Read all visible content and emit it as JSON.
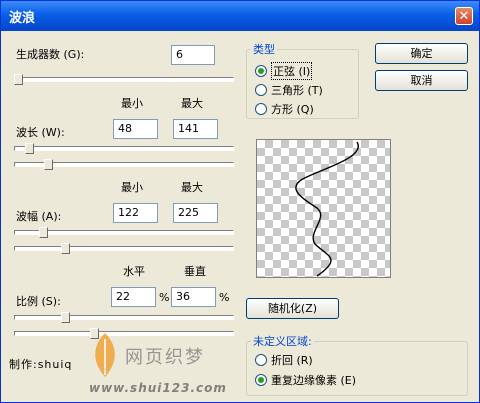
{
  "window": {
    "title": "波浪",
    "close_glyph": "✕"
  },
  "generators": {
    "label": "生成器数",
    "key": "(G):",
    "value": "6",
    "slider_fraction": 0.0
  },
  "min_max_header_1": {
    "min": "最小",
    "max": "最大"
  },
  "wavelength": {
    "label": "波长",
    "key": "(W):",
    "min": "48",
    "max": "141",
    "min_fraction": 0.05,
    "max_fraction": 0.14
  },
  "min_max_header_2": {
    "min": "最小",
    "max": "最大"
  },
  "amplitude": {
    "label": "波幅",
    "key": "(A):",
    "min": "122",
    "max": "225",
    "min_fraction": 0.12,
    "max_fraction": 0.22
  },
  "hv_header": {
    "h": "水平",
    "v": "垂直"
  },
  "scale": {
    "label": "比例",
    "key": "(S):",
    "h": "22",
    "v": "36",
    "unit": "%",
    "h_fraction": 0.22,
    "v_fraction": 0.36
  },
  "type_group": {
    "legend": "类型",
    "options": [
      {
        "label": "正弦",
        "key": "(I)",
        "selected": true
      },
      {
        "label": "三角形",
        "key": "(T)",
        "selected": false
      },
      {
        "label": "方形",
        "key": "(Q)",
        "selected": false
      }
    ]
  },
  "buttons": {
    "ok": "确定",
    "cancel": "取消",
    "randomize": "随机化(Z)"
  },
  "undefined_group": {
    "legend": "未定义区域:",
    "options": [
      {
        "label": "折回",
        "key": "(R)",
        "selected": false
      },
      {
        "label": "重复边缘像素",
        "key": "(E)",
        "selected": true
      }
    ]
  },
  "watermark": {
    "author": "制作:shuiq",
    "site_name": "网页织梦",
    "url": "www.shui123.com"
  }
}
